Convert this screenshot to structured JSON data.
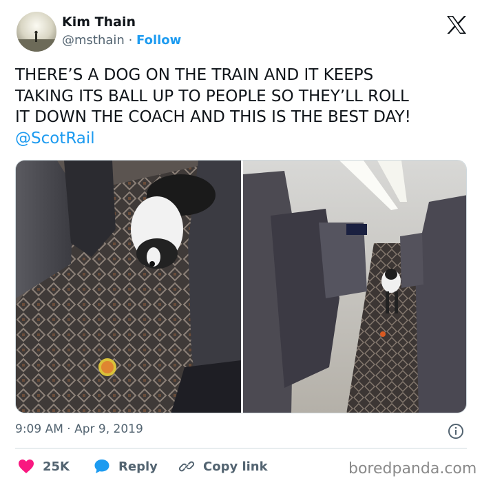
{
  "author": {
    "name": "Kim Thain",
    "handle": "@msthain",
    "separator": "·",
    "follow_label": "Follow"
  },
  "logo_icon": "x-logo-icon",
  "tweet": {
    "lines": [
      "THERE’S A DOG ON THE TRAIN AND IT KEEPS",
      "TAKING ITS BALL UP TO PEOPLE SO THEY’LL ROLL",
      "IT DOWN THE COACH AND THIS IS THE BEST DAY!"
    ],
    "mention": "@ScotRail"
  },
  "meta": {
    "timestamp": "9:09 AM · Apr 9, 2019",
    "info_icon": "info-icon"
  },
  "actions": {
    "likes": "25K",
    "reply": "Reply",
    "copy_link": "Copy link"
  },
  "watermark": "boredpanda.com",
  "colors": {
    "accent": "#1d9bf0",
    "heart": "#f91880",
    "text": "#0f1419",
    "secondary": "#536471",
    "border": "#cfd9de"
  }
}
